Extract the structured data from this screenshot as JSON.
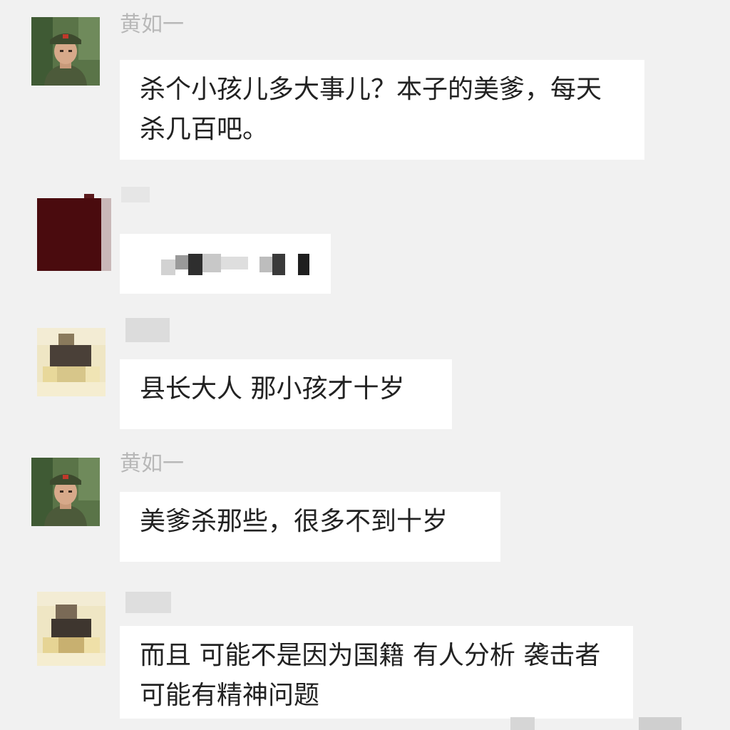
{
  "messages": [
    {
      "sender": "黄如一",
      "text": "杀个小孩儿多大事儿？本子的美爹，每天杀几百吧。",
      "avatar_icon": "soldier-avatar-icon"
    },
    {
      "sender": "",
      "text": "",
      "avatar_icon": "pixelated-dark-red-avatar-icon",
      "redacted": true
    },
    {
      "sender": "",
      "text": "县长大人 那小孩才十岁",
      "avatar_icon": "pixelated-avatar-icon",
      "sender_redacted": true
    },
    {
      "sender": "黄如一",
      "text": "美爹杀那些，很多不到十岁",
      "avatar_icon": "soldier-avatar-icon"
    },
    {
      "sender": "",
      "text": "而且 可能不是因为国籍 有人分析 袭击者 可能有精神问题",
      "avatar_icon": "pixelated-avatar-icon",
      "sender_redacted": true
    }
  ],
  "colors": {
    "background": "#f1f1f1",
    "bubble": "#ffffff",
    "text": "#222222",
    "sender_name": "#b8b8b8"
  }
}
